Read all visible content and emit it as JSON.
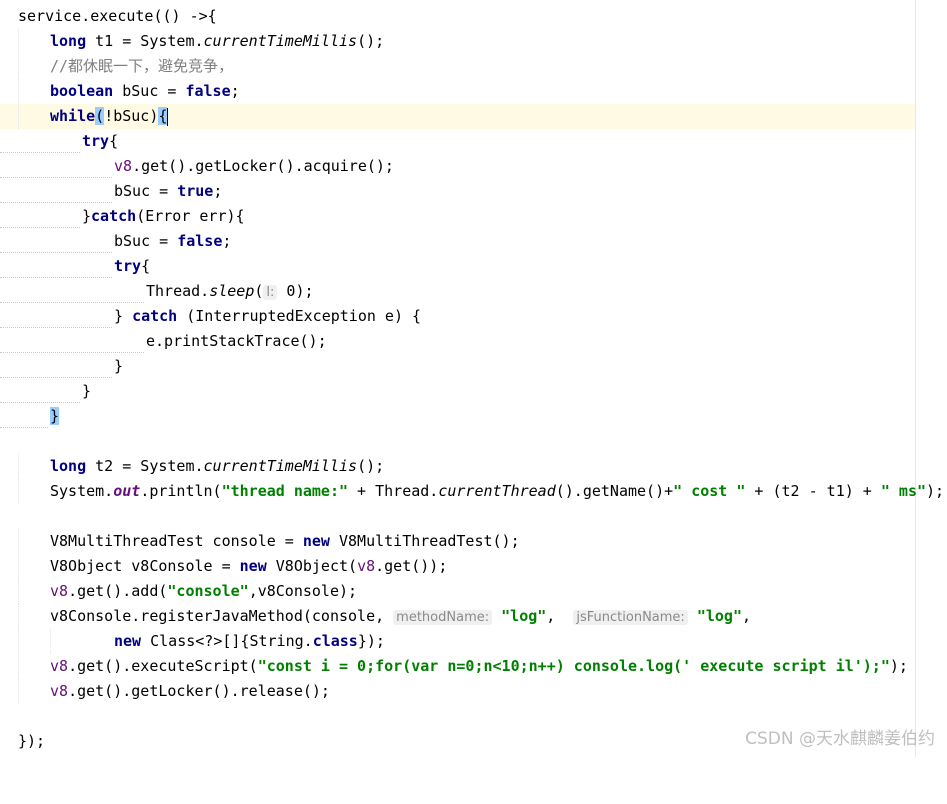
{
  "editor": {
    "lines": [
      [
        "service.execute(() ->{"
      ],
      [
        "long",
        " t1 = System.",
        "currentTimeMillis",
        "();"
      ],
      [
        "//都休眠一下，避免竞争，"
      ],
      [
        "boolean",
        " bSuc = ",
        "false",
        ";"
      ],
      [
        "while",
        "(",
        "!bSuc)",
        "{"
      ],
      [
        "try",
        "{"
      ],
      [
        "v8",
        ".get().getLocker().acquire();"
      ],
      [
        "bSuc = ",
        "true",
        ";"
      ],
      [
        "}",
        "catch",
        "(Error err){"
      ],
      [
        "bSuc = ",
        "false",
        ";"
      ],
      [
        "try",
        "{"
      ],
      [
        "Thread.",
        "sleep",
        "(",
        "l:",
        " 0);"
      ],
      [
        "} ",
        "catch",
        " (InterruptedException e) {"
      ],
      [
        "e.printStackTrace();"
      ],
      [
        "}"
      ],
      [
        "}"
      ],
      [
        "}"
      ],
      [
        ""
      ],
      [
        "long",
        " t2 = System.",
        "currentTimeMillis",
        "();"
      ],
      [
        "System.",
        "out",
        ".println(",
        "\"thread name:\"",
        " + Thread.",
        "currentThread",
        "().getName()+",
        "\" cost \"",
        " + (t2 - t1) + ",
        "\" ms\"",
        ");"
      ],
      [
        ""
      ],
      [
        "V8MultiThreadTest console = ",
        "new",
        " V8MultiThreadTest();"
      ],
      [
        "V8Object v8Console = ",
        "new",
        " V8Object(",
        "v8",
        ".get());"
      ],
      [
        "v8",
        ".get().add(",
        "\"console\"",
        ",v8Console);"
      ],
      [
        "v8Console.registerJavaMethod(console, ",
        "methodName:",
        " ",
        "\"log\"",
        ",  ",
        "jsFunctionName:",
        " ",
        "\"log\"",
        ","
      ],
      [
        "new",
        " Class<?>[]{String.",
        "class",
        "});"
      ],
      [
        "v8",
        ".get().executeScript(",
        "\"const i = 0;for(var n=0;n<10;n++) console.log(' execute script il');\"",
        ");"
      ],
      [
        "v8",
        ".get().getLocker().release();"
      ],
      [
        ""
      ],
      [
        "});"
      ]
    ]
  },
  "watermark": "CSDN @天水麒麟姜伯约"
}
